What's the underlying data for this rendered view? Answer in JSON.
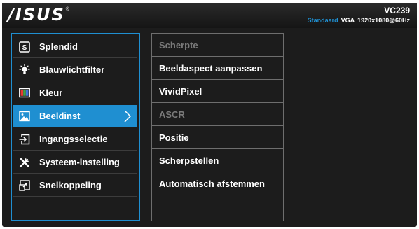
{
  "brand": {
    "logo_text": "/ISUS",
    "registered_mark": "®"
  },
  "monitor": {
    "model": "VC239",
    "mode": "Standaard",
    "input": "VGA",
    "resolution": "1920x1080@60Hz"
  },
  "main_menu": {
    "items": [
      {
        "label": "Splendid",
        "icon": "splendid-icon",
        "selected": false
      },
      {
        "label": "Blauwlichtfilter",
        "icon": "lightbulb-icon",
        "selected": false
      },
      {
        "label": "Kleur",
        "icon": "color-icon",
        "selected": false
      },
      {
        "label": "Beeldinst",
        "icon": "image-icon",
        "selected": true
      },
      {
        "label": "Ingangsselectie",
        "icon": "input-select-icon",
        "selected": false
      },
      {
        "label": "Systeem-instelling",
        "icon": "tools-icon",
        "selected": false
      },
      {
        "label": "Snelkoppeling",
        "icon": "shortcut-icon",
        "selected": false
      }
    ]
  },
  "sub_menu": {
    "items": [
      {
        "label": "Scherpte",
        "enabled": false
      },
      {
        "label": "Beeldaspect aanpassen",
        "enabled": true
      },
      {
        "label": "VividPixel",
        "enabled": true
      },
      {
        "label": "ASCR",
        "enabled": false
      },
      {
        "label": "Positie",
        "enabled": true
      },
      {
        "label": "Scherpstellen",
        "enabled": true
      },
      {
        "label": "Automatisch afstemmen",
        "enabled": true
      }
    ]
  },
  "colors": {
    "accent": "#1f8fd1",
    "background": "#1c1c1c",
    "disabled_text": "#7a7a7a"
  }
}
